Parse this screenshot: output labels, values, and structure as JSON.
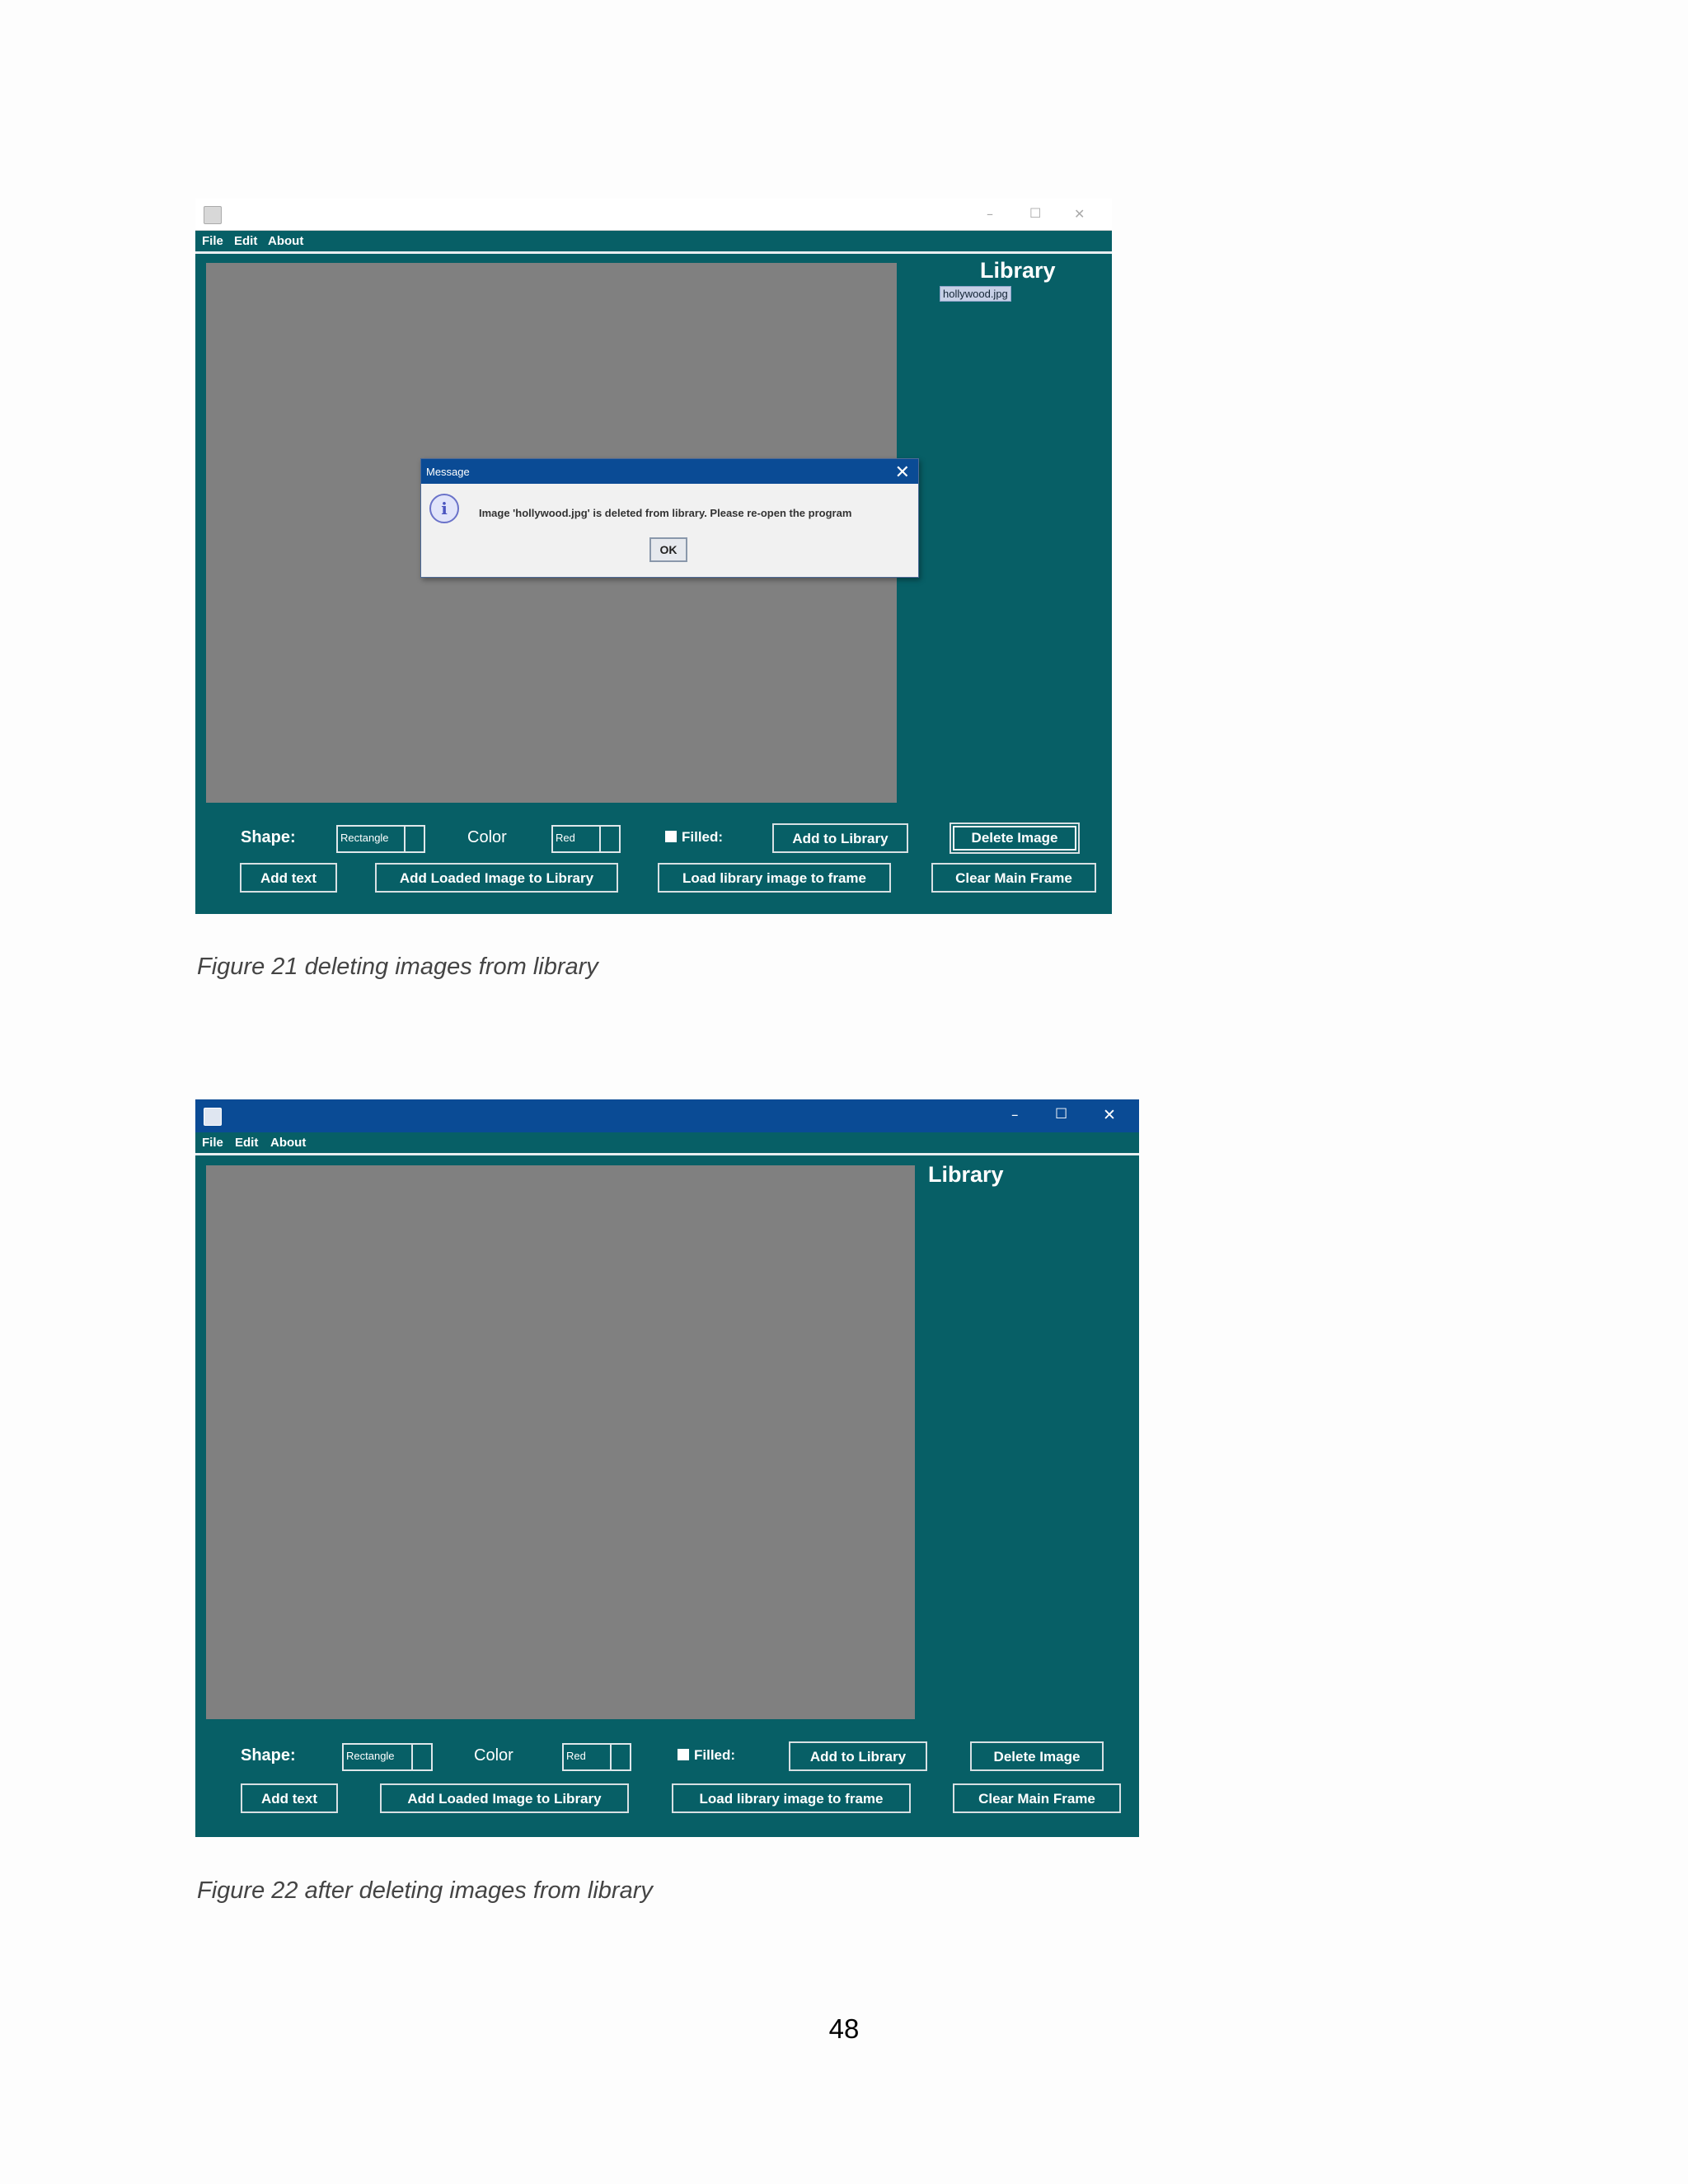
{
  "figure21": {
    "menu": [
      "File",
      "Edit",
      "About"
    ],
    "window_controls": {
      "minimize": "–",
      "maximize": "☐",
      "close": "✕"
    },
    "library_title": "Library",
    "library_items": [
      "hollywood.jpg"
    ],
    "dialog": {
      "title": "Message",
      "close": "✕",
      "message": "Image 'hollywood.jpg' is deleted from library. Please re-open the program",
      "ok_label": "OK"
    },
    "shape_label": "Shape:",
    "shape_value": "Rectangle",
    "color_label": "Color",
    "color_value": "Red",
    "filled_label": "Filled:",
    "buttons": {
      "add_to_library": "Add to Library",
      "delete_image": "Delete Image",
      "add_text": "Add text",
      "add_loaded": "Add Loaded Image to Library",
      "load_library": "Load library image to frame",
      "clear_main": "Clear Main Frame"
    },
    "caption": "Figure 21 deleting images from library"
  },
  "figure22": {
    "menu": [
      "File",
      "Edit",
      "About"
    ],
    "window_controls": {
      "minimize": "–",
      "maximize": "☐",
      "close": "✕"
    },
    "library_title": "Library",
    "shape_label": "Shape:",
    "shape_value": "Rectangle",
    "color_label": "Color",
    "color_value": "Red",
    "filled_label": "Filled:",
    "buttons": {
      "add_to_library": "Add to Library",
      "delete_image": "Delete Image",
      "add_text": "Add text",
      "add_loaded": "Add Loaded Image to Library",
      "load_library": "Load library image to frame",
      "clear_main": "Clear Main Frame"
    },
    "caption": "Figure 22 after deleting images from library"
  },
  "page_number": "48",
  "colors": {
    "app_bg": "#075f66",
    "canvas": "#808080",
    "titlebar_active": "#0a4b95"
  }
}
